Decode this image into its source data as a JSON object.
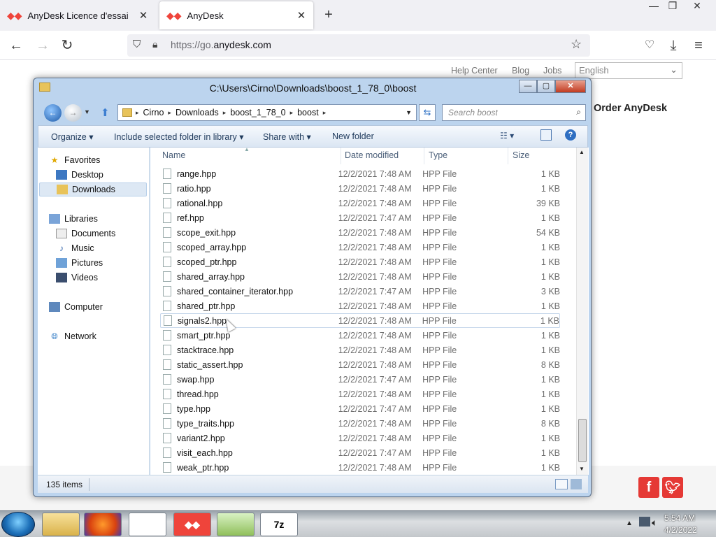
{
  "browser": {
    "tabs": [
      {
        "label": "AnyDesk Licence d'essai"
      },
      {
        "label": "AnyDesk"
      }
    ],
    "newtab": "+",
    "url": {
      "prefix": "https://go.",
      "domain": "anydesk.com"
    },
    "window_controls": {
      "minimize": "—",
      "restore": "❐",
      "close": "✕"
    }
  },
  "website": {
    "nav": {
      "help": "Help Center",
      "blog": "Blog",
      "jobs": "Jobs"
    },
    "language": "English",
    "order": "Order AnyDesk"
  },
  "explorer": {
    "title": "C:\\Users\\Cirno\\Downloads\\boost_1_78_0\\boost",
    "breadcrumb": [
      "Cirno",
      "Downloads",
      "boost_1_78_0",
      "boost"
    ],
    "search_placeholder": "Search boost",
    "commands": {
      "organize": "Organize ▾",
      "include": "Include selected folder in library ▾",
      "share": "Share with ▾",
      "newfolder": "New folder"
    },
    "nav": {
      "favorites": "Favorites",
      "desktop": "Desktop",
      "downloads": "Downloads",
      "libraries": "Libraries",
      "documents": "Documents",
      "music": "Music",
      "pictures": "Pictures",
      "videos": "Videos",
      "computer": "Computer",
      "network": "Network"
    },
    "columns": {
      "name": "Name",
      "date": "Date modified",
      "type": "Type",
      "size": "Size"
    },
    "files": [
      {
        "name": "range.hpp",
        "date": "12/2/2021 7:48 AM",
        "type": "HPP File",
        "size": "1 KB"
      },
      {
        "name": "ratio.hpp",
        "date": "12/2/2021 7:48 AM",
        "type": "HPP File",
        "size": "1 KB"
      },
      {
        "name": "rational.hpp",
        "date": "12/2/2021 7:48 AM",
        "type": "HPP File",
        "size": "39 KB"
      },
      {
        "name": "ref.hpp",
        "date": "12/2/2021 7:47 AM",
        "type": "HPP File",
        "size": "1 KB"
      },
      {
        "name": "scope_exit.hpp",
        "date": "12/2/2021 7:48 AM",
        "type": "HPP File",
        "size": "54 KB"
      },
      {
        "name": "scoped_array.hpp",
        "date": "12/2/2021 7:48 AM",
        "type": "HPP File",
        "size": "1 KB"
      },
      {
        "name": "scoped_ptr.hpp",
        "date": "12/2/2021 7:48 AM",
        "type": "HPP File",
        "size": "1 KB"
      },
      {
        "name": "shared_array.hpp",
        "date": "12/2/2021 7:48 AM",
        "type": "HPP File",
        "size": "1 KB"
      },
      {
        "name": "shared_container_iterator.hpp",
        "date": "12/2/2021 7:47 AM",
        "type": "HPP File",
        "size": "3 KB"
      },
      {
        "name": "shared_ptr.hpp",
        "date": "12/2/2021 7:48 AM",
        "type": "HPP File",
        "size": "1 KB"
      },
      {
        "name": "signals2.hpp",
        "date": "12/2/2021 7:48 AM",
        "type": "HPP File",
        "size": "1 KB"
      },
      {
        "name": "smart_ptr.hpp",
        "date": "12/2/2021 7:48 AM",
        "type": "HPP File",
        "size": "1 KB"
      },
      {
        "name": "stacktrace.hpp",
        "date": "12/2/2021 7:48 AM",
        "type": "HPP File",
        "size": "1 KB"
      },
      {
        "name": "static_assert.hpp",
        "date": "12/2/2021 7:48 AM",
        "type": "HPP File",
        "size": "8 KB"
      },
      {
        "name": "swap.hpp",
        "date": "12/2/2021 7:47 AM",
        "type": "HPP File",
        "size": "1 KB"
      },
      {
        "name": "thread.hpp",
        "date": "12/2/2021 7:48 AM",
        "type": "HPP File",
        "size": "1 KB"
      },
      {
        "name": "type.hpp",
        "date": "12/2/2021 7:47 AM",
        "type": "HPP File",
        "size": "1 KB"
      },
      {
        "name": "type_traits.hpp",
        "date": "12/2/2021 7:48 AM",
        "type": "HPP File",
        "size": "8 KB"
      },
      {
        "name": "variant2.hpp",
        "date": "12/2/2021 7:48 AM",
        "type": "HPP File",
        "size": "1 KB"
      },
      {
        "name": "visit_each.hpp",
        "date": "12/2/2021 7:47 AM",
        "type": "HPP File",
        "size": "1 KB"
      },
      {
        "name": "weak_ptr.hpp",
        "date": "12/2/2021 7:48 AM",
        "type": "HPP File",
        "size": "1 KB"
      }
    ],
    "status": "135 items"
  },
  "taskbar": {
    "time": "5:54 AM",
    "date": "4/2/2022",
    "sevenzip": "7z"
  },
  "colors": {
    "anydesk_red": "#ef443b",
    "selection": "#dde8f4"
  }
}
